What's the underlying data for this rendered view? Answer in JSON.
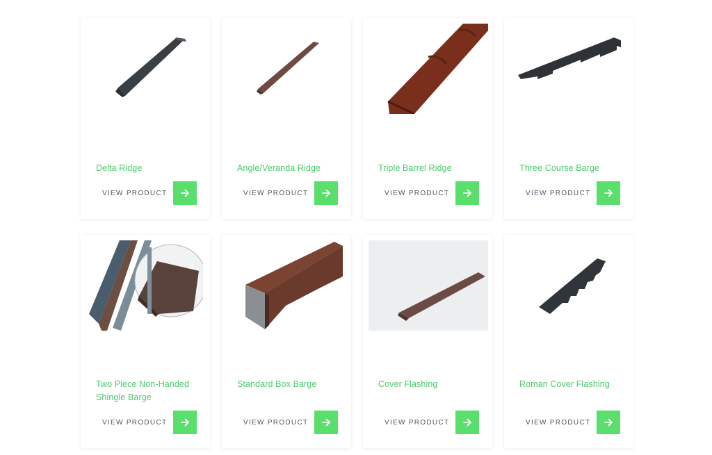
{
  "products": [
    {
      "name": "Delta Ridge",
      "cta": "VIEW PRODUCT"
    },
    {
      "name": "Angle/Veranda Ridge",
      "cta": "VIEW PRODUCT"
    },
    {
      "name": "Triple Barrel Ridge",
      "cta": "VIEW PRODUCT"
    },
    {
      "name": "Three Course Barge",
      "cta": "VIEW PRODUCT"
    },
    {
      "name": "Two Piece Non-Handed Shingle Barge",
      "cta": "VIEW PRODUCT"
    },
    {
      "name": "Standard Box Barge",
      "cta": "VIEW PRODUCT"
    },
    {
      "name": "Cover Flashing",
      "cta": "VIEW PRODUCT"
    },
    {
      "name": "Roman Cover Flashing",
      "cta": "VIEW PRODUCT"
    }
  ],
  "colors": {
    "accent_text": "#4cc96a",
    "accent_button": "#5ade6c"
  },
  "icons": {
    "cta_arrow": "arrow-right-icon"
  }
}
